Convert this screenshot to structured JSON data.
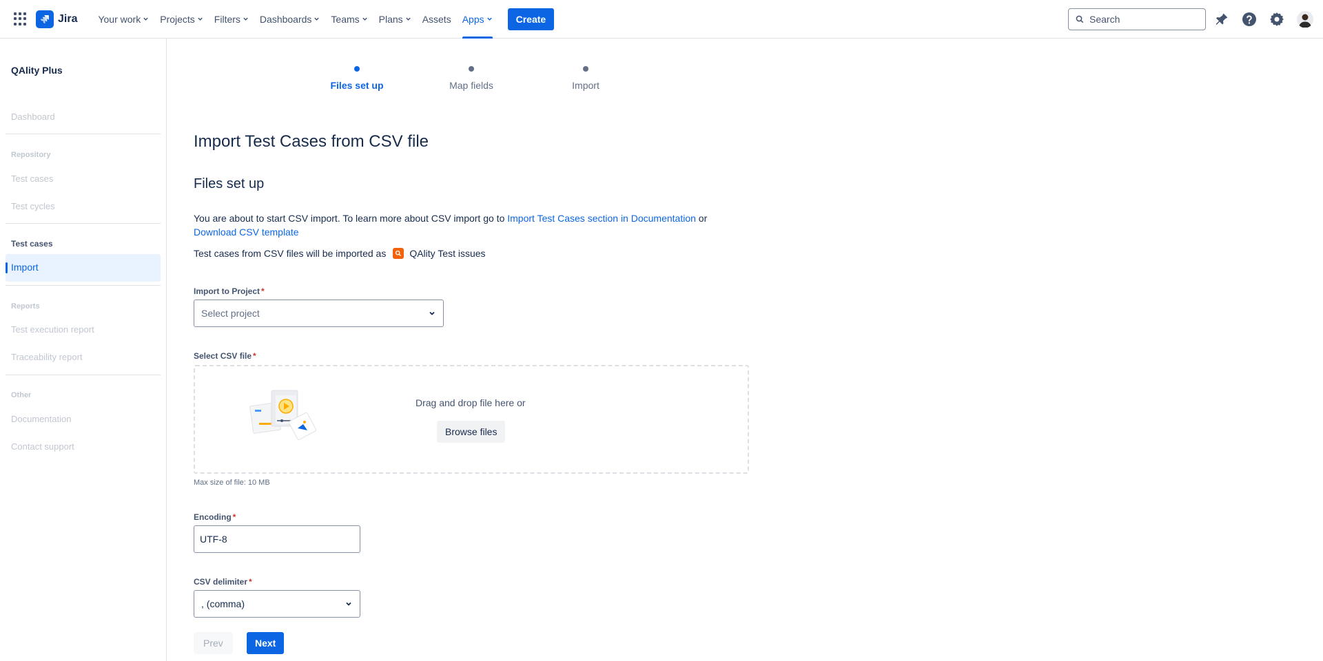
{
  "topnav": {
    "app_name": "Jira",
    "items": [
      {
        "label": "Your work"
      },
      {
        "label": "Projects"
      },
      {
        "label": "Filters"
      },
      {
        "label": "Dashboards"
      },
      {
        "label": "Teams"
      },
      {
        "label": "Plans"
      },
      {
        "label": "Assets"
      },
      {
        "label": "Apps"
      }
    ],
    "active_item": "Apps",
    "create_label": "Create",
    "search_placeholder": "Search",
    "icons": [
      "notifications-icon",
      "help-icon",
      "settings-icon",
      "avatar"
    ],
    "accent_color": "#0c66e4"
  },
  "sidebar": {
    "title": "QAlity Plus",
    "dashboard": "Dashboard",
    "repository_section": "Repository",
    "repository_items": [
      "Test cases",
      "Test cycles"
    ],
    "test_cases_section": "Test cases",
    "active_item": "Import",
    "reports_section": "Reports",
    "reports_items": [
      "Test execution report",
      "Traceability report"
    ],
    "other_section": "Other",
    "other_items": [
      "Documentation",
      "Contact support"
    ]
  },
  "stepper": {
    "steps": [
      {
        "label": "Files set up",
        "active": true
      },
      {
        "label": "Map fields",
        "active": false
      },
      {
        "label": "Import",
        "active": false
      }
    ]
  },
  "main": {
    "page_title": "Import Test Cases from CSV file",
    "section_title": "Files set up",
    "intro_text": "You are about to start CSV import. To learn more about CSV import go to ",
    "doc_link": "Import Test Cases section in Documentation",
    "intro_or": " or",
    "template_link": "Download CSV template",
    "issue_text": "Test cases from CSV files will be imported as",
    "issue_type": "QAlity Test issues",
    "project_label": "Import to Project",
    "project_placeholder": "Select project",
    "csv_label": "Select CSV file",
    "drop_text": "Drag and drop file here or",
    "browse_label": "Browse files",
    "max_size": "Max size of file: 10 MB",
    "encoding_label": "Encoding",
    "encoding_value": "UTF-8",
    "delimiter_label": "CSV delimiter",
    "delimiter_value": ", (comma)",
    "required_mark": "*",
    "prev_label": "Prev",
    "next_label": "Next"
  }
}
